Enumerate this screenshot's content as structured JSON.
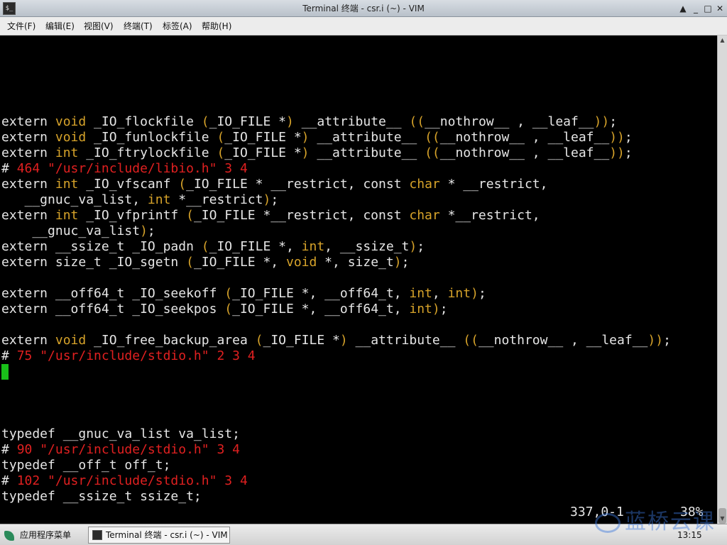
{
  "window": {
    "title": "Terminal 终端 - csr.i (~) - VIM",
    "buttons": [
      "▲",
      "_",
      "□",
      "✕"
    ]
  },
  "menu": [
    "文件(F)",
    "编辑(E)",
    "视图(V)",
    "终端(T)",
    "标签(A)",
    "帮助(H)"
  ],
  "editor": {
    "lines": [
      [
        [
          "t",
          "extern "
        ],
        [
          "k",
          "void"
        ],
        [
          "t",
          " _IO_flockfile "
        ],
        [
          "p",
          "("
        ],
        [
          "t",
          "_IO_FILE *"
        ],
        [
          "p",
          ")"
        ],
        [
          "t",
          " __attribute__ "
        ],
        [
          "p",
          "(("
        ],
        [
          "t",
          "__nothrow__ , __leaf__"
        ],
        [
          "p",
          "))"
        ],
        [
          "t",
          ";"
        ]
      ],
      [
        [
          "t",
          "extern "
        ],
        [
          "k",
          "void"
        ],
        [
          "t",
          " _IO_funlockfile "
        ],
        [
          "p",
          "("
        ],
        [
          "t",
          "_IO_FILE *"
        ],
        [
          "p",
          ")"
        ],
        [
          "t",
          " __attribute__ "
        ],
        [
          "p",
          "(("
        ],
        [
          "t",
          "__nothrow__ , __leaf__"
        ],
        [
          "p",
          "))"
        ],
        [
          "t",
          ";"
        ]
      ],
      [
        [
          "t",
          "extern "
        ],
        [
          "k",
          "int"
        ],
        [
          "t",
          " _IO_ftrylockfile "
        ],
        [
          "p",
          "("
        ],
        [
          "t",
          "_IO_FILE *"
        ],
        [
          "p",
          ")"
        ],
        [
          "t",
          " __attribute__ "
        ],
        [
          "p",
          "(("
        ],
        [
          "t",
          "__nothrow__ , __leaf__"
        ],
        [
          "p",
          "))"
        ],
        [
          "t",
          ";"
        ]
      ],
      [
        [
          "t",
          "# "
        ],
        [
          "c",
          "464 \"/usr/include/libio.h\" 3 4"
        ]
      ],
      [
        [
          "t",
          "extern "
        ],
        [
          "k",
          "int"
        ],
        [
          "t",
          " _IO_vfscanf "
        ],
        [
          "p",
          "("
        ],
        [
          "t",
          "_IO_FILE * __restrict, const "
        ],
        [
          "k",
          "char"
        ],
        [
          "t",
          " * __restrict,"
        ]
      ],
      [
        [
          "t",
          "   __gnuc_va_list, "
        ],
        [
          "k",
          "int"
        ],
        [
          "t",
          " *__restrict"
        ],
        [
          "p",
          ")"
        ],
        [
          "t",
          ";"
        ]
      ],
      [
        [
          "t",
          "extern "
        ],
        [
          "k",
          "int"
        ],
        [
          "t",
          " _IO_vfprintf "
        ],
        [
          "p",
          "("
        ],
        [
          "t",
          "_IO_FILE *__restrict, const "
        ],
        [
          "k",
          "char"
        ],
        [
          "t",
          " *__restrict,"
        ]
      ],
      [
        [
          "t",
          "    __gnuc_va_list"
        ],
        [
          "p",
          ")"
        ],
        [
          "t",
          ";"
        ]
      ],
      [
        [
          "t",
          "extern __ssize_t _IO_padn "
        ],
        [
          "p",
          "("
        ],
        [
          "t",
          "_IO_FILE *, "
        ],
        [
          "k",
          "int"
        ],
        [
          "t",
          ", __ssize_t"
        ],
        [
          "p",
          ")"
        ],
        [
          "t",
          ";"
        ]
      ],
      [
        [
          "t",
          "extern size_t _IO_sgetn "
        ],
        [
          "p",
          "("
        ],
        [
          "t",
          "_IO_FILE *, "
        ],
        [
          "k",
          "void"
        ],
        [
          "t",
          " *, size_t"
        ],
        [
          "p",
          ")"
        ],
        [
          "t",
          ";"
        ]
      ],
      [],
      [
        [
          "t",
          "extern __off64_t _IO_seekoff "
        ],
        [
          "p",
          "("
        ],
        [
          "t",
          "_IO_FILE *, __off64_t, "
        ],
        [
          "k",
          "int"
        ],
        [
          "t",
          ", "
        ],
        [
          "k",
          "int"
        ],
        [
          "p",
          ")"
        ],
        [
          "t",
          ";"
        ]
      ],
      [
        [
          "t",
          "extern __off64_t _IO_seekpos "
        ],
        [
          "p",
          "("
        ],
        [
          "t",
          "_IO_FILE *, __off64_t, "
        ],
        [
          "k",
          "int"
        ],
        [
          "p",
          ")"
        ],
        [
          "t",
          ";"
        ]
      ],
      [],
      [
        [
          "t",
          "extern "
        ],
        [
          "k",
          "void"
        ],
        [
          "t",
          " _IO_free_backup_area "
        ],
        [
          "p",
          "("
        ],
        [
          "t",
          "_IO_FILE *"
        ],
        [
          "p",
          ")"
        ],
        [
          "t",
          " __attribute__ "
        ],
        [
          "p",
          "(("
        ],
        [
          "t",
          "__nothrow__ , __leaf__"
        ],
        [
          "p",
          "))"
        ],
        [
          "t",
          ";"
        ]
      ],
      [
        [
          "t",
          "# "
        ],
        [
          "c",
          "75 \"/usr/include/stdio.h\" 2 3 4"
        ]
      ],
      [],
      [],
      [],
      [],
      [
        [
          "t",
          "typedef __gnuc_va_list va_list;"
        ]
      ],
      [
        [
          "t",
          "# "
        ],
        [
          "c",
          "90 \"/usr/include/stdio.h\" 3 4"
        ]
      ],
      [
        [
          "t",
          "typedef __off_t off_t;"
        ]
      ],
      [
        [
          "t",
          "# "
        ],
        [
          "c",
          "102 \"/usr/include/stdio.h\" 3 4"
        ]
      ],
      [
        [
          "t",
          "typedef __ssize_t ssize_t;"
        ]
      ]
    ],
    "ruler_position": "337,0-1",
    "ruler_percent": "38%"
  },
  "colors": {
    "background": "#000000",
    "text": "#e6e6e6",
    "keyword": "#d7a32a",
    "comment": "#e02020",
    "cursor": "#19c019"
  },
  "taskbar": {
    "start_label": "应用程序菜单",
    "task_label": "Terminal 终端 - csr.i (~) - VIM",
    "clock": "13:15",
    "watermark": "蓝桥云课"
  }
}
